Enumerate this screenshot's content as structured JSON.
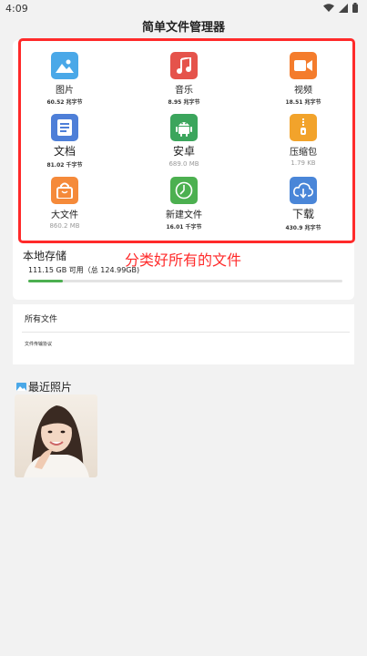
{
  "status_bar": {
    "time": "4:09"
  },
  "app": {
    "title": "简单文件管理器"
  },
  "categories": [
    {
      "label": "图片",
      "sub": "60.52 兆字节",
      "icon": "image-icon",
      "color": "#4aa8e8"
    },
    {
      "label": "音乐",
      "sub": "8.95 兆字节",
      "icon": "music-icon",
      "color": "#e5534b"
    },
    {
      "label": "视频",
      "sub": "18.51 兆字节",
      "icon": "video-icon",
      "color": "#f47c2c"
    },
    {
      "label": "文档",
      "sub": "81.02 千字节",
      "icon": "document-icon",
      "color": "#4e7fd8"
    },
    {
      "label": "安卓",
      "sub": "689.0 MB",
      "icon": "android-icon",
      "color": "#3ba55c"
    },
    {
      "label": "压缩包",
      "sub": "1.79 KB",
      "icon": "zip-icon",
      "color": "#f2a32b"
    },
    {
      "label": "大文件",
      "sub": "860.2 MB",
      "icon": "shopping-bag-icon",
      "color": "#f58a3a"
    },
    {
      "label": "新建文件",
      "sub": "16.01 千字节",
      "icon": "clock-icon",
      "color": "#4cb050"
    },
    {
      "label": "下载",
      "sub": "430.9 兆字节",
      "icon": "download-cloud-icon",
      "color": "#4a86d8"
    }
  ],
  "storage": {
    "title": "本地存储",
    "info": "111.15 GB 可用（总 124.99GB)",
    "used_fraction": 0.11
  },
  "annotation": {
    "caption": "分类好所有的文件"
  },
  "list": {
    "all_files": "所有文件",
    "privacy": "文件传输协议"
  },
  "recent": {
    "title": "最近照片"
  },
  "colors": {
    "accent": "#4caf50",
    "highlight": "#ff2a2a"
  }
}
